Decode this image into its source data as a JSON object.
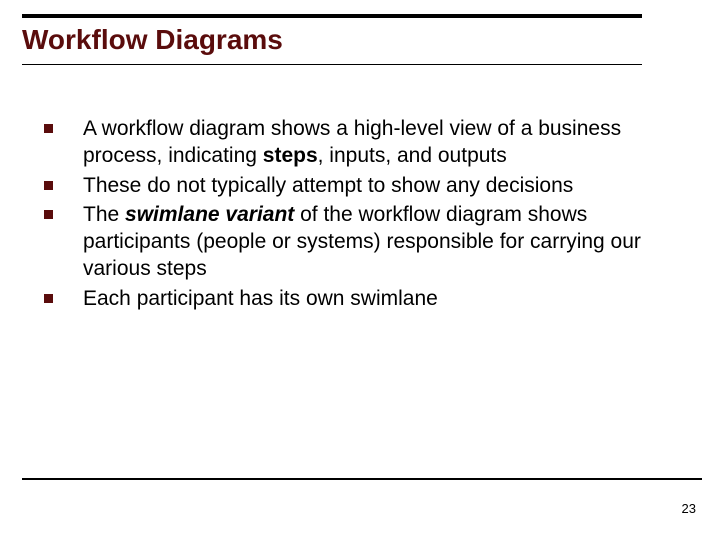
{
  "title": "Workflow Diagrams",
  "bullets": [
    {
      "parts": [
        {
          "text": "A workflow diagram shows a high-level view of a business process, indicating ",
          "style": "normal"
        },
        {
          "text": "steps",
          "style": "bold"
        },
        {
          "text": ", inputs, and outputs",
          "style": "normal"
        }
      ]
    },
    {
      "parts": [
        {
          "text": "These do not typically attempt to show any decisions",
          "style": "normal"
        }
      ]
    },
    {
      "parts": [
        {
          "text": "The ",
          "style": "normal"
        },
        {
          "text": "swimlane variant",
          "style": "bold-italic"
        },
        {
          "text": " of the workflow diagram shows participants (people or systems) responsible for carrying our various steps",
          "style": "normal"
        }
      ]
    },
    {
      "parts": [
        {
          "text": "Each participant has its own swimlane",
          "style": "normal"
        }
      ]
    }
  ],
  "page_number": "23"
}
